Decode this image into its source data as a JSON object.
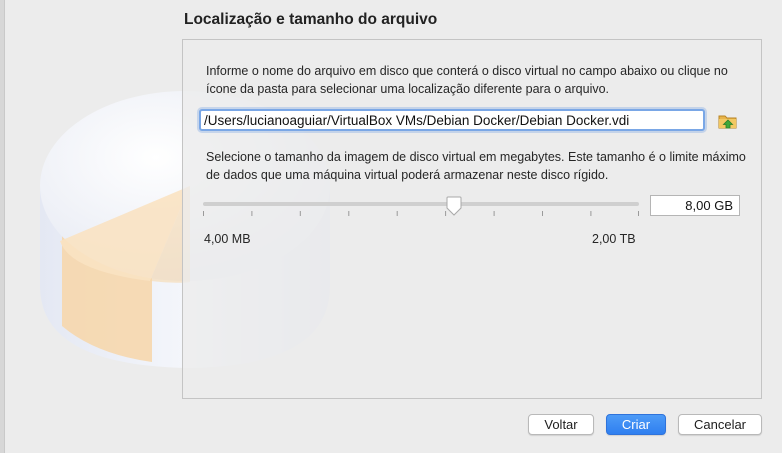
{
  "header": {
    "title": "Localização e tamanho do arquivo"
  },
  "location": {
    "description": "Informe o nome do arquivo em disco que conterá o disco virtual no campo abaixo ou clique no ícone da pasta para selecionar uma localização diferente para o arquivo.",
    "path_value": "/Users/lucianoaguiar/VirtualBox VMs/Debian Docker/Debian Docker.vdi",
    "folder_icon": "folder-icon"
  },
  "size": {
    "description": "Selecione o tamanho da imagem de disco virtual em megabytes. Este tamanho é o limite máximo de dados que uma máquina virtual poderá armazenar neste disco rígido.",
    "value": "8,00 GB",
    "min_label": "4,00 MB",
    "max_label": "2,00 TB",
    "slider_fraction": 0.575
  },
  "buttons": {
    "back": "Voltar",
    "create": "Criar",
    "cancel": "Cancelar"
  },
  "colors": {
    "accent": "#2f7ff0",
    "focus_ring": "#7aa7e6"
  }
}
